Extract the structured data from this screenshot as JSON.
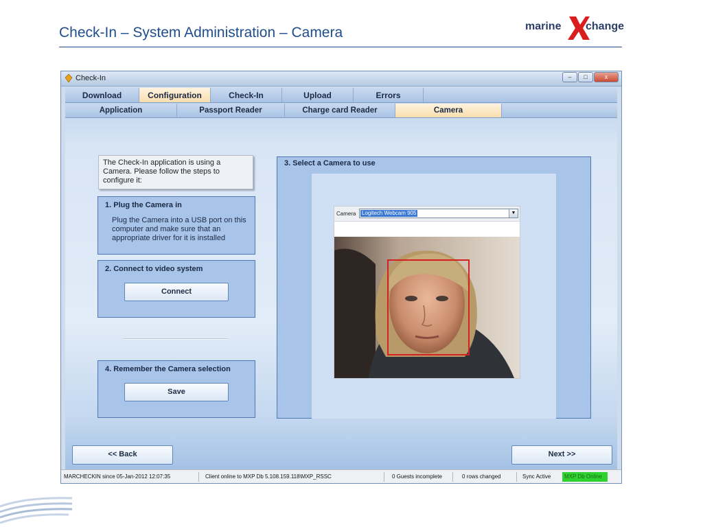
{
  "slide": {
    "title": "Check-In – System Administration – Camera",
    "logo": {
      "left": "marine",
      "middle": "X",
      "right": "change"
    }
  },
  "window": {
    "title": "Check-In",
    "controls": {
      "minimize": "–",
      "maximize": "□",
      "close": "x"
    }
  },
  "tabs_main": [
    {
      "label": "Download",
      "active": false
    },
    {
      "label": "Configuration",
      "active": true
    },
    {
      "label": "Check-In",
      "active": false
    },
    {
      "label": "Upload",
      "active": false
    },
    {
      "label": "Errors",
      "active": false
    }
  ],
  "tabs_sub": [
    {
      "label": "Application",
      "active": false
    },
    {
      "label": "Passport Reader",
      "active": false
    },
    {
      "label": "Charge card Reader",
      "active": false
    },
    {
      "label": "Camera",
      "active": true
    }
  ],
  "intro": {
    "text": "The Check-In application is using a Camera. Please follow the steps to configure it:"
  },
  "step1": {
    "title": "1. Plug the Camera in",
    "text": "Plug the Camera into a USB port on this computer and make sure that an appropriate driver for it is installed"
  },
  "step2": {
    "title": "2. Connect to video system",
    "button": "Connect"
  },
  "step3": {
    "title": "3. Select a Camera to use",
    "camera_label": "Camera",
    "camera_selected": "Logitech Webcam 905"
  },
  "step4": {
    "title": "4. Remember the Camera selection",
    "button": "Save"
  },
  "nav": {
    "back": "<< Back",
    "next": "Next >>"
  },
  "status": {
    "user": "MARCHECKIN since 05-Jan-2012 12:07:35",
    "client": "Client online to MXP Db 5.108.159.118\\MXP_RSSC",
    "guests": "0 Guests incomplete",
    "rows": "0 rows changed",
    "sync": "Sync Active",
    "db": "MXP Db Online"
  },
  "colors": {
    "title_blue": "#1f4e8c",
    "active_tab": "#f8ddae",
    "panel": "#a9c4e9",
    "face_box": "#d42020",
    "db_online": "#2fd12f"
  }
}
